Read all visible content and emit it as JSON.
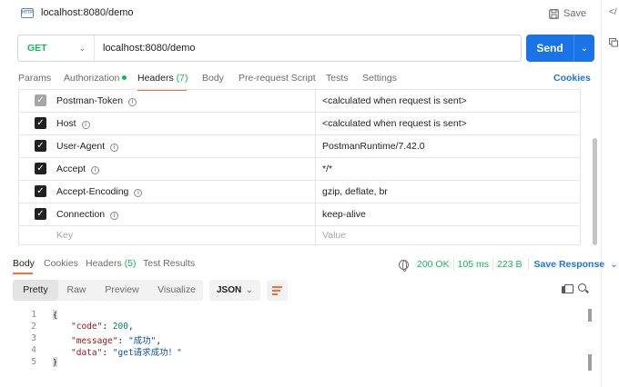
{
  "request": {
    "title": "localhost:8080/demo",
    "http_badge": "HTTP",
    "save_label": "Save",
    "method": "GET",
    "url": "localhost:8080/demo",
    "send_label": "Send"
  },
  "request_tabs": {
    "params": "Params",
    "authorization": "Authorization",
    "headers": "Headers",
    "headers_count": "(7)",
    "body": "Body",
    "prerequest": "Pre-request Script",
    "tests": "Tests",
    "settings": "Settings",
    "cookies": "Cookies"
  },
  "headers": [
    {
      "key": "Postman-Token",
      "value": "<calculated when request is sent>",
      "checked": true,
      "muted": true
    },
    {
      "key": "Host",
      "value": "<calculated when request is sent>",
      "checked": true,
      "muted": false
    },
    {
      "key": "User-Agent",
      "value": "PostmanRuntime/7.42.0",
      "checked": true,
      "muted": false
    },
    {
      "key": "Accept",
      "value": "*/*",
      "checked": true,
      "muted": false
    },
    {
      "key": "Accept-Encoding",
      "value": "gzip, deflate, br",
      "checked": true,
      "muted": false
    },
    {
      "key": "Connection",
      "value": "keep-alive",
      "checked": true,
      "muted": false
    }
  ],
  "headers_empty_row": {
    "key_placeholder": "Key",
    "value_placeholder": "Value"
  },
  "response_tabs": {
    "body": "Body",
    "cookies": "Cookies",
    "headers": "Headers",
    "headers_count": "(5)",
    "test_results": "Test Results"
  },
  "response_status": {
    "status": "200 OK",
    "time": "105 ms",
    "size": "223 B",
    "save_response": "Save Response"
  },
  "format_tabs": [
    "Pretty",
    "Raw",
    "Preview",
    "Visualize"
  ],
  "format_select": "JSON",
  "response_body": {
    "line_numbers": [
      "1",
      "2",
      "3",
      "4",
      "5"
    ],
    "open_brace": "{",
    "close_brace": "}",
    "code_key": "\"code\"",
    "code_value": "200",
    "message_key": "\"message\"",
    "message_value": "\"成功\"",
    "data_key": "\"data\"",
    "data_value": "\"get请求成功！\""
  },
  "colors": {
    "accent": "#ff6c37",
    "send": "#1b73e8",
    "method_get": "#0cbb52",
    "status_ok": "#0cbb52"
  }
}
